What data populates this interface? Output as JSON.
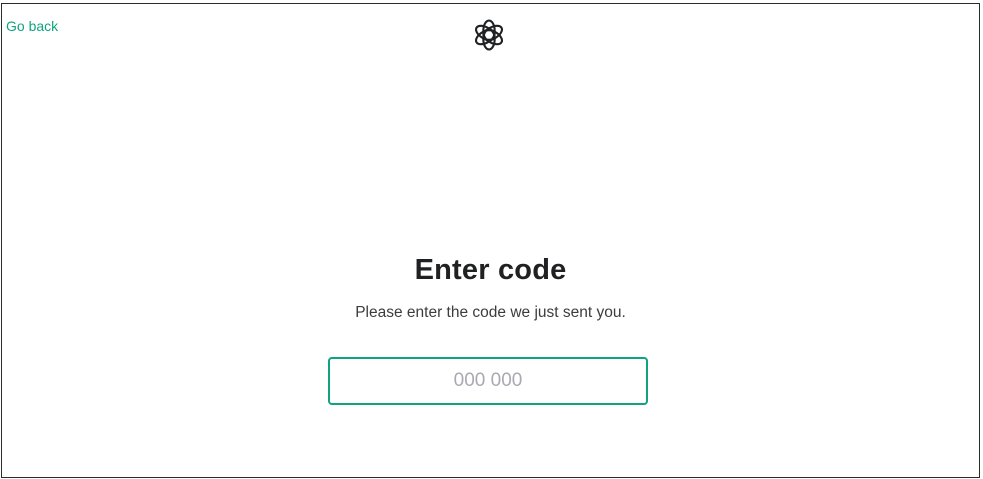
{
  "nav": {
    "back_label": "Go back"
  },
  "brand": {
    "logo_icon": "openai-logo-icon"
  },
  "main": {
    "title": "Enter code",
    "subtitle": "Please enter the code we just sent you.",
    "code_input": {
      "value": "",
      "placeholder": "000 000"
    }
  },
  "colors": {
    "accent": "#10a37f",
    "text": "#202123",
    "muted": "#a9a9b3"
  }
}
